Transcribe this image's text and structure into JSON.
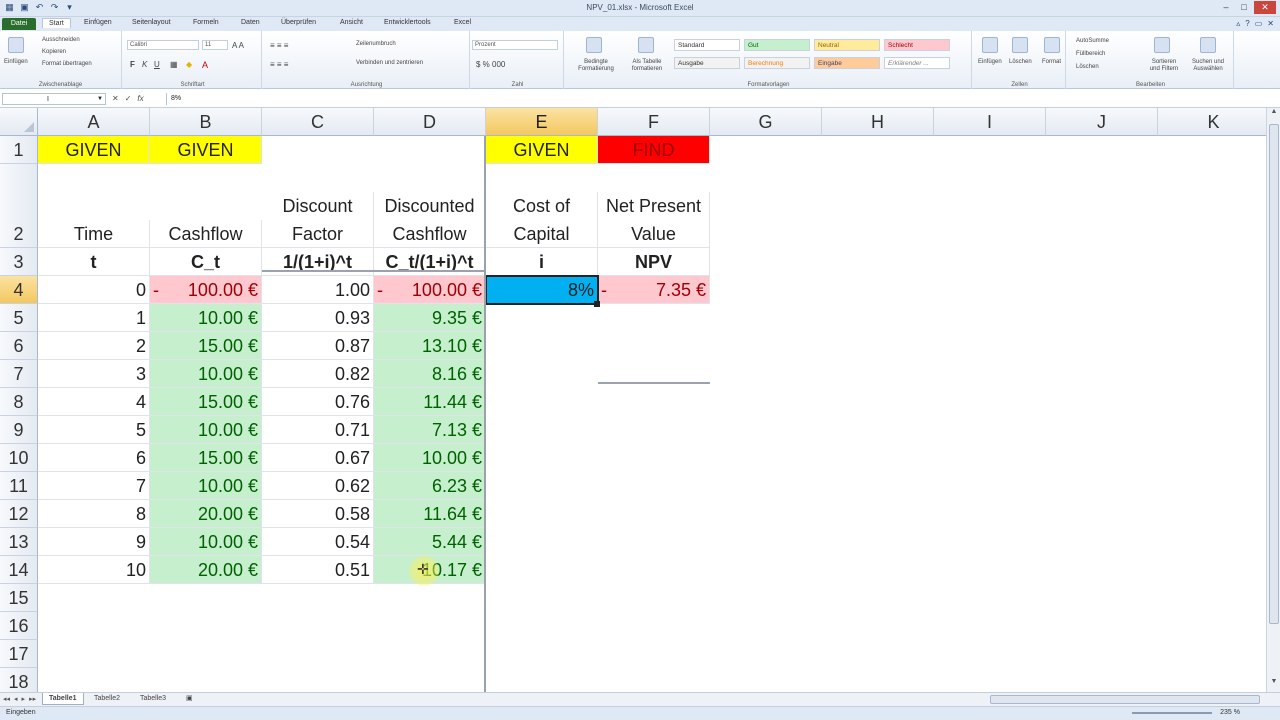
{
  "window": {
    "title": "NPV_01.xlsx - Microsoft Excel"
  },
  "ribbon": {
    "tabs": [
      "Datei",
      "Start",
      "Einfügen",
      "Seitenlayout",
      "Formeln",
      "Daten",
      "Überprüfen",
      "Ansicht",
      "Entwicklertools",
      "Excel"
    ],
    "active_tab": "Start",
    "clipboard": {
      "paste": "Einfügen",
      "cut": "Ausschneiden",
      "copy": "Kopieren",
      "format_painter": "Format übertragen",
      "group": "Zwischenablage"
    },
    "font": {
      "name": "Calibri",
      "size": "11",
      "bold": "F",
      "italic": "K",
      "underline": "U",
      "group": "Schriftart"
    },
    "alignment": {
      "wrap": "Zeilenumbruch",
      "merge": "Verbinden und zentrieren",
      "group": "Ausrichtung"
    },
    "number": {
      "format": "Prozent",
      "group": "Zahl"
    },
    "styles": {
      "conditional": "Bedingte Formatierung",
      "as_table": "Als Tabelle formatieren",
      "standard": "Standard",
      "gut": "Gut",
      "neutral": "Neutral",
      "schlecht": "Schlecht",
      "ausgabe": "Ausgabe",
      "berechnung": "Berechnung",
      "eingabe": "Eingabe",
      "erklaerend": "Erklärender ...",
      "group": "Formatvorlagen"
    },
    "cells": {
      "insert": "Einfügen",
      "delete": "Löschen",
      "format": "Format",
      "group": "Zellen"
    },
    "editing": {
      "autosum": "AutoSumme",
      "fill": "Füllbereich",
      "clear": "Löschen",
      "sort": "Sortieren und Filtern",
      "find": "Suchen und Auswählen",
      "group": "Bearbeiten"
    }
  },
  "formula_bar": {
    "name_box": "I",
    "content": "8%"
  },
  "grid": {
    "columns": [
      "A",
      "B",
      "C",
      "D",
      "E",
      "F",
      "G",
      "H",
      "I",
      "J",
      "K"
    ],
    "rows": [
      "1",
      "2",
      "3",
      "4",
      "5",
      "6",
      "7",
      "8",
      "9",
      "10",
      "11",
      "12",
      "13",
      "14",
      "15",
      "16",
      "17",
      "18"
    ],
    "row1": {
      "A": "GIVEN",
      "B": "GIVEN",
      "E": "GIVEN",
      "F": "FIND"
    },
    "row2": {
      "A": "Time",
      "B": "Cashflow",
      "C1": "Discount",
      "C2": "Factor",
      "D1": "Discounted",
      "D2": "Cashflow",
      "E1": "Cost of",
      "E2": "Capital",
      "F1": "Net Present",
      "F2": "Value"
    },
    "row3": {
      "A": "t",
      "B": "C_t",
      "C": "1/(1+i)^t",
      "D": "C_t/(1+i)^t",
      "E": "i",
      "F": "NPV"
    },
    "data": [
      {
        "t": "0",
        "cashflow": "100.00 €",
        "cf_neg": "-",
        "factor": "1.00",
        "disc": "100.00 €",
        "disc_neg": "-"
      },
      {
        "t": "1",
        "cashflow": "10.00 €",
        "cf_neg": "",
        "factor": "0.93",
        "disc": "9.35 €",
        "disc_neg": ""
      },
      {
        "t": "2",
        "cashflow": "15.00 €",
        "cf_neg": "",
        "factor": "0.87",
        "disc": "13.10 €",
        "disc_neg": ""
      },
      {
        "t": "3",
        "cashflow": "10.00 €",
        "cf_neg": "",
        "factor": "0.82",
        "disc": "8.16 €",
        "disc_neg": ""
      },
      {
        "t": "4",
        "cashflow": "15.00 €",
        "cf_neg": "",
        "factor": "0.76",
        "disc": "11.44 €",
        "disc_neg": ""
      },
      {
        "t": "5",
        "cashflow": "10.00 €",
        "cf_neg": "",
        "factor": "0.71",
        "disc": "7.13 €",
        "disc_neg": ""
      },
      {
        "t": "6",
        "cashflow": "15.00 €",
        "cf_neg": "",
        "factor": "0.67",
        "disc": "10.00 €",
        "disc_neg": ""
      },
      {
        "t": "7",
        "cashflow": "10.00 €",
        "cf_neg": "",
        "factor": "0.62",
        "disc": "6.23 €",
        "disc_neg": ""
      },
      {
        "t": "8",
        "cashflow": "20.00 €",
        "cf_neg": "",
        "factor": "0.58",
        "disc": "11.64 €",
        "disc_neg": ""
      },
      {
        "t": "9",
        "cashflow": "10.00 €",
        "cf_neg": "",
        "factor": "0.54",
        "disc": "5.44 €",
        "disc_neg": ""
      },
      {
        "t": "10",
        "cashflow": "20.00 €",
        "cf_neg": "",
        "factor": "0.51",
        "disc": "10.17 €",
        "disc_neg": ""
      }
    ],
    "cost_of_capital": "8%",
    "npv_sign": "-",
    "npv": "7.35 €"
  },
  "sheets": [
    "Tabelle1",
    "Tabelle2",
    "Tabelle3"
  ],
  "active_sheet": "Tabelle1",
  "status": {
    "mode": "Eingeben",
    "zoom": "235 %"
  },
  "colors": {
    "given": "#ffff00",
    "find": "#ff0000",
    "positive_fill": "#c6efce",
    "negative_fill": "#ffc7ce",
    "input_fill": "#00b0f0"
  }
}
